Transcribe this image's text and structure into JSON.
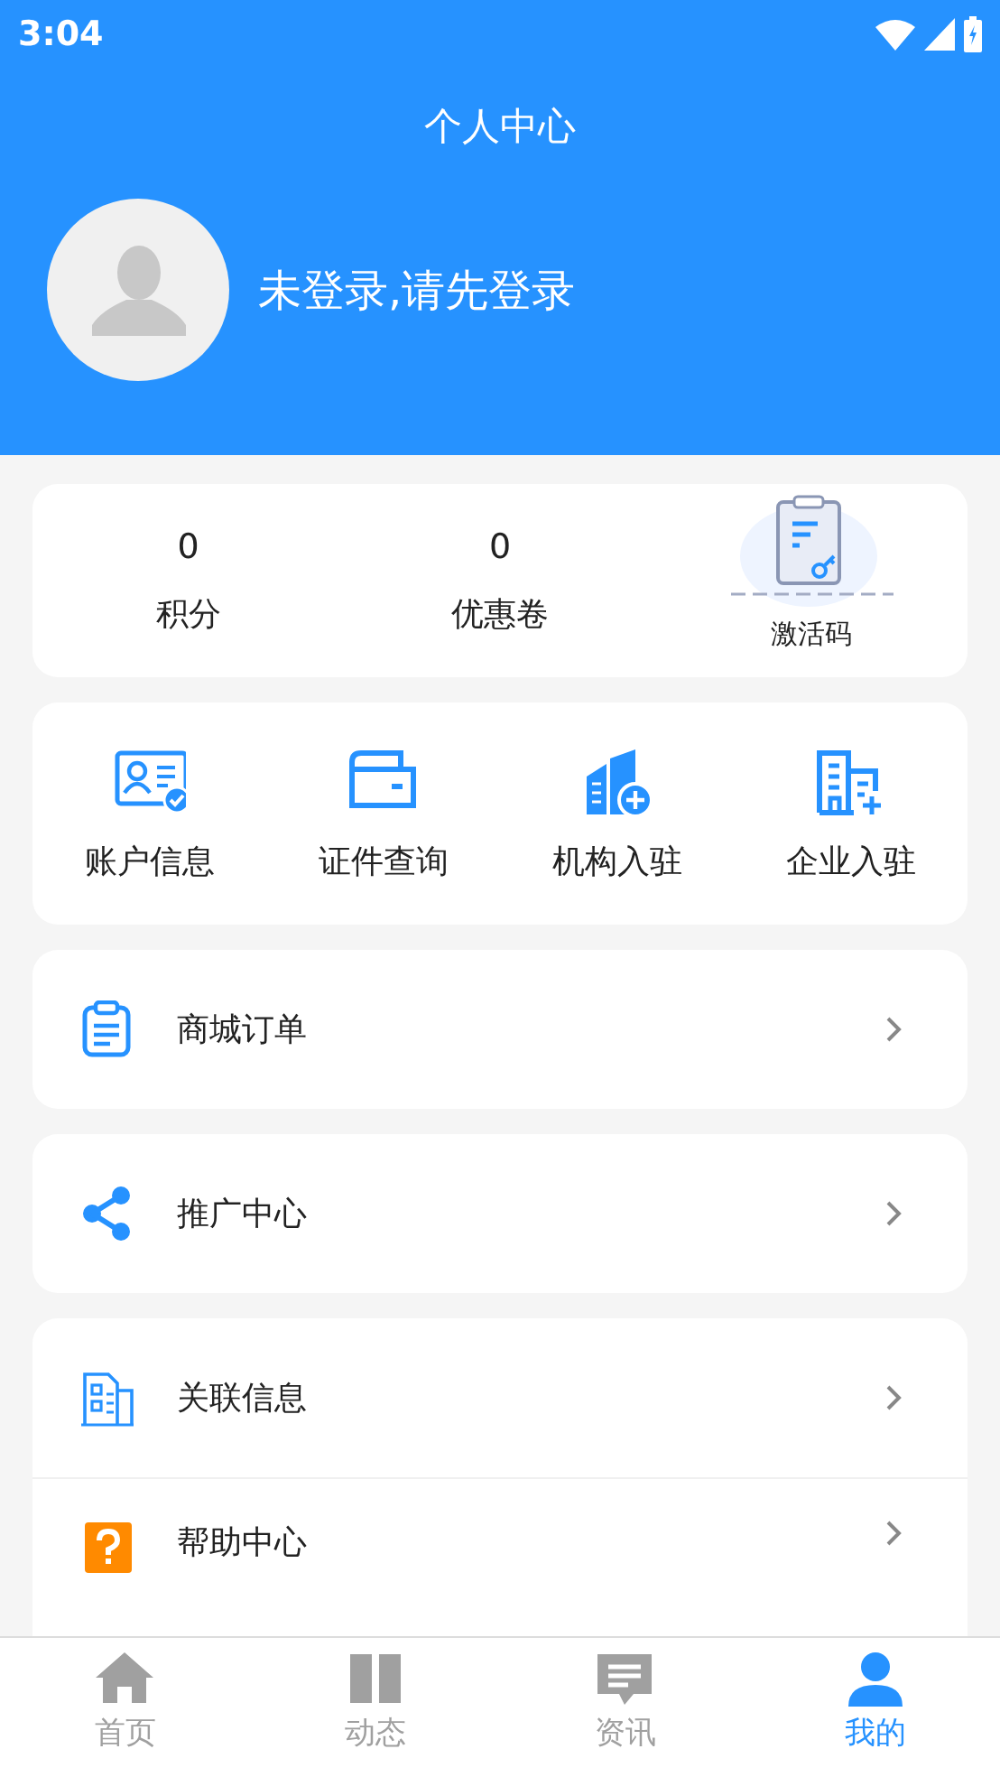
{
  "status_bar": {
    "time": "3:04"
  },
  "header": {
    "title": "个人中心",
    "login_prompt": "未登录,请先登录"
  },
  "stats": [
    {
      "kind": "count",
      "value": "0",
      "label": "积分"
    },
    {
      "kind": "count",
      "value": "0",
      "label": "优惠卷"
    },
    {
      "kind": "icon",
      "label": "激活码"
    }
  ],
  "services": [
    {
      "kind": "account",
      "label": "账户信息"
    },
    {
      "kind": "wallet",
      "label": "证件查询"
    },
    {
      "kind": "institution",
      "label": "机构入驻"
    },
    {
      "kind": "enterprise",
      "label": "企业入驻"
    }
  ],
  "menu_groups": [
    [
      {
        "kind": "order",
        "label": "商城订单"
      }
    ],
    [
      {
        "kind": "share",
        "label": "推广中心"
      }
    ],
    [
      {
        "kind": "related",
        "label": "关联信息"
      },
      {
        "kind": "help",
        "label": "帮助中心"
      }
    ]
  ],
  "tab_bar": [
    {
      "kind": "home",
      "label": "首页",
      "selected": false
    },
    {
      "kind": "feed",
      "label": "动态",
      "selected": false
    },
    {
      "kind": "news",
      "label": "资讯",
      "selected": false
    },
    {
      "kind": "me",
      "label": "我的",
      "selected": true
    }
  ]
}
